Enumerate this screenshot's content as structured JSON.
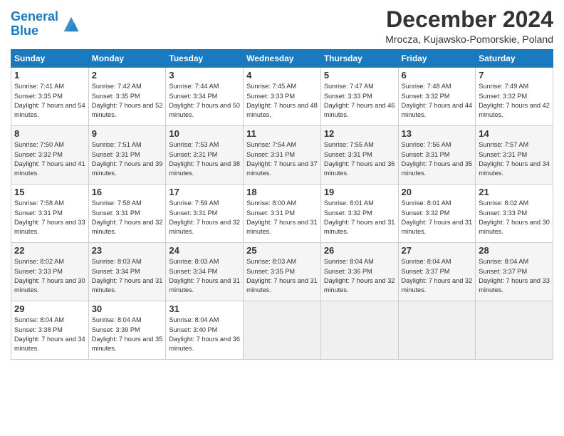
{
  "header": {
    "logo_line1": "General",
    "logo_line2": "Blue",
    "title": "December 2024",
    "subtitle": "Mrocza, Kujawsko-Pomorskie, Poland"
  },
  "weekdays": [
    "Sunday",
    "Monday",
    "Tuesday",
    "Wednesday",
    "Thursday",
    "Friday",
    "Saturday"
  ],
  "weeks": [
    [
      {
        "day": "1",
        "sunrise": "Sunrise: 7:41 AM",
        "sunset": "Sunset: 3:35 PM",
        "daylight": "Daylight: 7 hours and 54 minutes."
      },
      {
        "day": "2",
        "sunrise": "Sunrise: 7:42 AM",
        "sunset": "Sunset: 3:35 PM",
        "daylight": "Daylight: 7 hours and 52 minutes."
      },
      {
        "day": "3",
        "sunrise": "Sunrise: 7:44 AM",
        "sunset": "Sunset: 3:34 PM",
        "daylight": "Daylight: 7 hours and 50 minutes."
      },
      {
        "day": "4",
        "sunrise": "Sunrise: 7:45 AM",
        "sunset": "Sunset: 3:33 PM",
        "daylight": "Daylight: 7 hours and 48 minutes."
      },
      {
        "day": "5",
        "sunrise": "Sunrise: 7:47 AM",
        "sunset": "Sunset: 3:33 PM",
        "daylight": "Daylight: 7 hours and 46 minutes."
      },
      {
        "day": "6",
        "sunrise": "Sunrise: 7:48 AM",
        "sunset": "Sunset: 3:32 PM",
        "daylight": "Daylight: 7 hours and 44 minutes."
      },
      {
        "day": "7",
        "sunrise": "Sunrise: 7:49 AM",
        "sunset": "Sunset: 3:32 PM",
        "daylight": "Daylight: 7 hours and 42 minutes."
      }
    ],
    [
      {
        "day": "8",
        "sunrise": "Sunrise: 7:50 AM",
        "sunset": "Sunset: 3:32 PM",
        "daylight": "Daylight: 7 hours and 41 minutes."
      },
      {
        "day": "9",
        "sunrise": "Sunrise: 7:51 AM",
        "sunset": "Sunset: 3:31 PM",
        "daylight": "Daylight: 7 hours and 39 minutes."
      },
      {
        "day": "10",
        "sunrise": "Sunrise: 7:53 AM",
        "sunset": "Sunset: 3:31 PM",
        "daylight": "Daylight: 7 hours and 38 minutes."
      },
      {
        "day": "11",
        "sunrise": "Sunrise: 7:54 AM",
        "sunset": "Sunset: 3:31 PM",
        "daylight": "Daylight: 7 hours and 37 minutes."
      },
      {
        "day": "12",
        "sunrise": "Sunrise: 7:55 AM",
        "sunset": "Sunset: 3:31 PM",
        "daylight": "Daylight: 7 hours and 36 minutes."
      },
      {
        "day": "13",
        "sunrise": "Sunrise: 7:56 AM",
        "sunset": "Sunset: 3:31 PM",
        "daylight": "Daylight: 7 hours and 35 minutes."
      },
      {
        "day": "14",
        "sunrise": "Sunrise: 7:57 AM",
        "sunset": "Sunset: 3:31 PM",
        "daylight": "Daylight: 7 hours and 34 minutes."
      }
    ],
    [
      {
        "day": "15",
        "sunrise": "Sunrise: 7:58 AM",
        "sunset": "Sunset: 3:31 PM",
        "daylight": "Daylight: 7 hours and 33 minutes."
      },
      {
        "day": "16",
        "sunrise": "Sunrise: 7:58 AM",
        "sunset": "Sunset: 3:31 PM",
        "daylight": "Daylight: 7 hours and 32 minutes."
      },
      {
        "day": "17",
        "sunrise": "Sunrise: 7:59 AM",
        "sunset": "Sunset: 3:31 PM",
        "daylight": "Daylight: 7 hours and 32 minutes."
      },
      {
        "day": "18",
        "sunrise": "Sunrise: 8:00 AM",
        "sunset": "Sunset: 3:31 PM",
        "daylight": "Daylight: 7 hours and 31 minutes."
      },
      {
        "day": "19",
        "sunrise": "Sunrise: 8:01 AM",
        "sunset": "Sunset: 3:32 PM",
        "daylight": "Daylight: 7 hours and 31 minutes."
      },
      {
        "day": "20",
        "sunrise": "Sunrise: 8:01 AM",
        "sunset": "Sunset: 3:32 PM",
        "daylight": "Daylight: 7 hours and 31 minutes."
      },
      {
        "day": "21",
        "sunrise": "Sunrise: 8:02 AM",
        "sunset": "Sunset: 3:33 PM",
        "daylight": "Daylight: 7 hours and 30 minutes."
      }
    ],
    [
      {
        "day": "22",
        "sunrise": "Sunrise: 8:02 AM",
        "sunset": "Sunset: 3:33 PM",
        "daylight": "Daylight: 7 hours and 30 minutes."
      },
      {
        "day": "23",
        "sunrise": "Sunrise: 8:03 AM",
        "sunset": "Sunset: 3:34 PM",
        "daylight": "Daylight: 7 hours and 31 minutes."
      },
      {
        "day": "24",
        "sunrise": "Sunrise: 8:03 AM",
        "sunset": "Sunset: 3:34 PM",
        "daylight": "Daylight: 7 hours and 31 minutes."
      },
      {
        "day": "25",
        "sunrise": "Sunrise: 8:03 AM",
        "sunset": "Sunset: 3:35 PM",
        "daylight": "Daylight: 7 hours and 31 minutes."
      },
      {
        "day": "26",
        "sunrise": "Sunrise: 8:04 AM",
        "sunset": "Sunset: 3:36 PM",
        "daylight": "Daylight: 7 hours and 32 minutes."
      },
      {
        "day": "27",
        "sunrise": "Sunrise: 8:04 AM",
        "sunset": "Sunset: 3:37 PM",
        "daylight": "Daylight: 7 hours and 32 minutes."
      },
      {
        "day": "28",
        "sunrise": "Sunrise: 8:04 AM",
        "sunset": "Sunset: 3:37 PM",
        "daylight": "Daylight: 7 hours and 33 minutes."
      }
    ],
    [
      {
        "day": "29",
        "sunrise": "Sunrise: 8:04 AM",
        "sunset": "Sunset: 3:38 PM",
        "daylight": "Daylight: 7 hours and 34 minutes."
      },
      {
        "day": "30",
        "sunrise": "Sunrise: 8:04 AM",
        "sunset": "Sunset: 3:39 PM",
        "daylight": "Daylight: 7 hours and 35 minutes."
      },
      {
        "day": "31",
        "sunrise": "Sunrise: 8:04 AM",
        "sunset": "Sunset: 3:40 PM",
        "daylight": "Daylight: 7 hours and 36 minutes."
      },
      null,
      null,
      null,
      null
    ]
  ]
}
